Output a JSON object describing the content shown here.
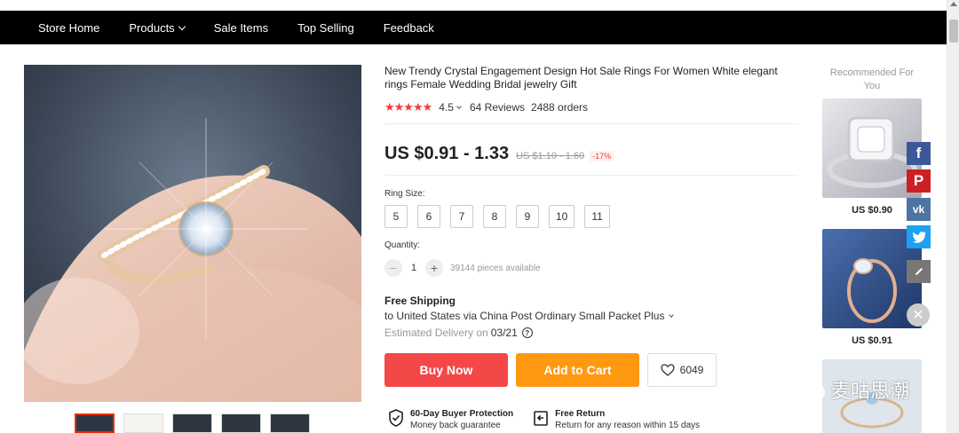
{
  "nav": {
    "items": [
      {
        "label": "Store Home"
      },
      {
        "label": "Products",
        "has_dropdown": true
      },
      {
        "label": "Sale Items"
      },
      {
        "label": "Top Selling"
      },
      {
        "label": "Feedback"
      }
    ]
  },
  "product": {
    "title": "New Trendy Crystal Engagement Design Hot Sale Rings For Women White elegant rings Female Wedding Bridal jewelry Gift",
    "rating": "4.5",
    "reviews": "64 Reviews",
    "orders": "2488 orders",
    "price": "US $0.91 - 1.33",
    "original_price": "US $1.10 - 1.60",
    "discount": "-17%",
    "ring_size_label": "Ring Size:",
    "sizes": [
      "5",
      "6",
      "7",
      "8",
      "9",
      "10",
      "11"
    ],
    "quantity_label": "Quantity:",
    "quantity": "1",
    "available": "39144 pieces available",
    "shipping_title": "Free Shipping",
    "shipping_to": "to United States via China Post Ordinary Small Packet Plus",
    "estimated_label": "Estimated Delivery on",
    "estimated_date": "03/21",
    "buy_now": "Buy Now",
    "add_to_cart": "Add to Cart",
    "wishlist_count": "6049"
  },
  "guarantees": [
    {
      "title": "60-Day Buyer Protection",
      "subtitle": "Money back guarantee",
      "icon": "shield-check-icon"
    },
    {
      "title": "Free Return",
      "subtitle": "Return for any reason within 15 days",
      "icon": "return-icon"
    }
  ],
  "recommended": {
    "title": "Recommended For You",
    "items": [
      {
        "price": "US $0.90"
      },
      {
        "price": "US $0.91"
      }
    ]
  },
  "social": [
    "facebook-icon",
    "pinterest-icon",
    "vk-icon",
    "twitter-icon",
    "edit-icon"
  ],
  "watermark": "麦咕思潮",
  "colors": {
    "nav_bg": "#000000",
    "buy_now": "#f44848",
    "add_to_cart": "#ff9911",
    "stars": "#f03c3c",
    "facebook": "#3b5998",
    "pinterest": "#cb2027",
    "vk": "#4c75a3",
    "twitter": "#1da1f2"
  }
}
